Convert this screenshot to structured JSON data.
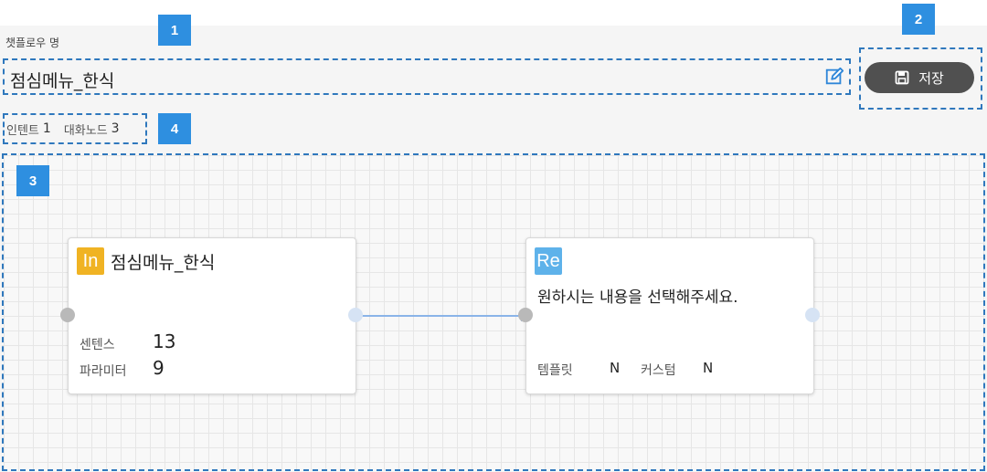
{
  "flow": {
    "field_label": "챗플로우 명",
    "name": "점심메뉴_한식",
    "edit_icon": "edit-icon"
  },
  "toolbar": {
    "save_label": "저장",
    "save_icon": "floppy-disk-icon"
  },
  "counts": {
    "intent_label": "인텐트",
    "intent_count": "1",
    "dialog_label": "대화노드",
    "dialog_count": "3"
  },
  "annotations": [
    "1",
    "2",
    "3",
    "4"
  ],
  "nodes": {
    "intent": {
      "type_badge": "In",
      "type_color": "#f0b323",
      "title": "점심메뉴_한식",
      "stats": [
        {
          "label": "센텐스",
          "value": "13"
        },
        {
          "label": "파라미터",
          "value": "9"
        }
      ]
    },
    "response": {
      "type_badge": "Re",
      "type_color": "#5eb2ea",
      "message": "원하시는 내용을 선택해주세요.",
      "stats": [
        {
          "label": "템플릿",
          "value": "N"
        },
        {
          "label": "커스텀",
          "value": "N"
        }
      ]
    }
  },
  "colors": {
    "annotation_blue": "#2e8fe0",
    "dashed_border": "#2f78bd",
    "save_button": "#505050",
    "connector": "#8ab4e8"
  }
}
